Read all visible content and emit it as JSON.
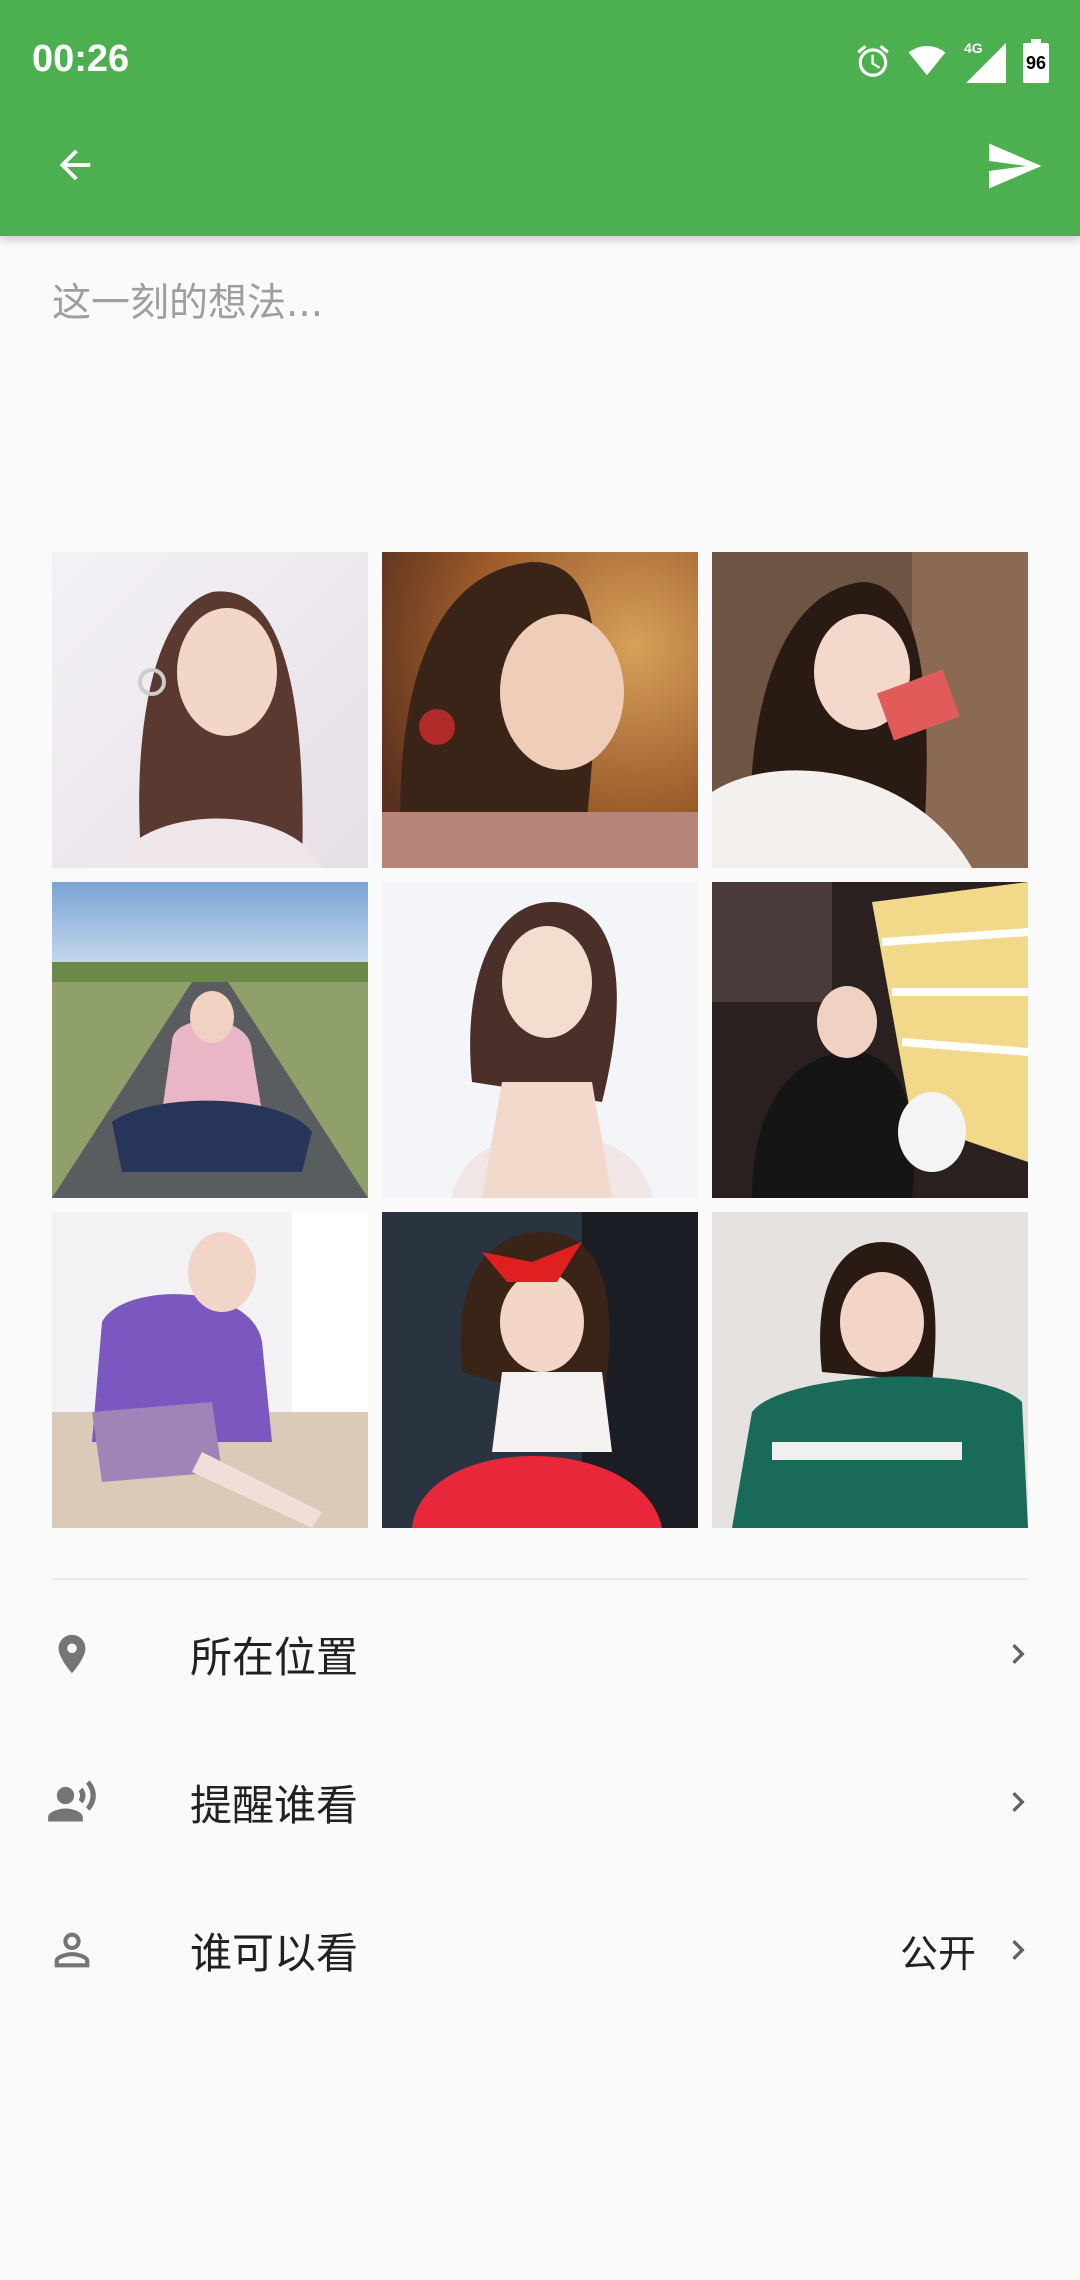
{
  "status_bar": {
    "time": "00:26",
    "network": "4G",
    "battery": "96"
  },
  "toolbar": {
    "back_icon": "arrow-left-icon",
    "send_icon": "send-icon",
    "color": "#4caf50"
  },
  "composer": {
    "placeholder": "这一刻的想法...",
    "value": ""
  },
  "photos": [
    {
      "icon": "photo-thumbnail"
    },
    {
      "icon": "photo-thumbnail"
    },
    {
      "icon": "photo-thumbnail"
    },
    {
      "icon": "photo-thumbnail"
    },
    {
      "icon": "photo-thumbnail"
    },
    {
      "icon": "photo-thumbnail"
    },
    {
      "icon": "photo-thumbnail"
    },
    {
      "icon": "photo-thumbnail"
    },
    {
      "icon": "photo-thumbnail"
    }
  ],
  "options": [
    {
      "label": "所在位置",
      "value": "",
      "icon": "location-pin-icon"
    },
    {
      "label": "提醒谁看",
      "value": "",
      "icon": "mention-person-icon"
    },
    {
      "label": "谁可以看",
      "value": "公开",
      "icon": "person-icon"
    }
  ]
}
